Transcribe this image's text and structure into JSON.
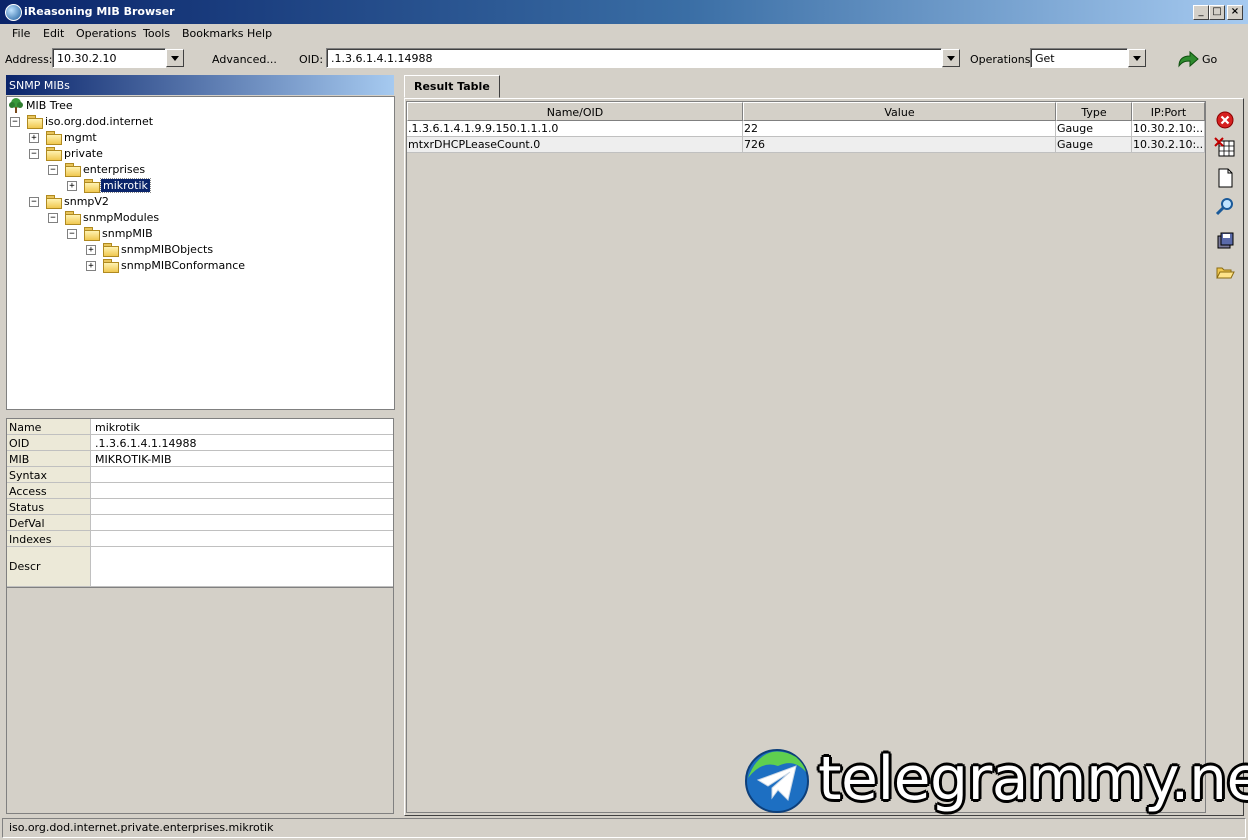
{
  "window": {
    "title": "iReasoning MIB Browser"
  },
  "menu": [
    "File",
    "Edit",
    "Operations",
    "Tools",
    "Bookmarks",
    "Help"
  ],
  "toolbar": {
    "address_label": "Address:",
    "address_value": "10.30.2.10",
    "advanced_label": "Advanced...",
    "oid_label": "OID:",
    "oid_value": ".1.3.6.1.4.1.14988",
    "operations_label": "Operations:",
    "operations_value": "Get",
    "go_label": "Go"
  },
  "left_panel": {
    "header": "SNMP MIBs",
    "tree": [
      {
        "label": "MIB Tree"
      },
      {
        "label": "iso.org.dod.internet"
      },
      {
        "label": "mgmt"
      },
      {
        "label": "private"
      },
      {
        "label": "enterprises"
      },
      {
        "label": "mikrotik"
      },
      {
        "label": "snmpV2"
      },
      {
        "label": "snmpModules"
      },
      {
        "label": "snmpMIB"
      },
      {
        "label": "snmpMIBObjects"
      },
      {
        "label": "snmpMIBConformance"
      }
    ],
    "properties": [
      {
        "key": "Name",
        "value": "mikrotik"
      },
      {
        "key": "OID",
        "value": ".1.3.6.1.4.1.14988"
      },
      {
        "key": "MIB",
        "value": "MIKROTIK-MIB"
      },
      {
        "key": "Syntax",
        "value": ""
      },
      {
        "key": "Access",
        "value": ""
      },
      {
        "key": "Status",
        "value": ""
      },
      {
        "key": "DefVal",
        "value": ""
      },
      {
        "key": "Indexes",
        "value": ""
      },
      {
        "key": "Descr",
        "value": ""
      }
    ]
  },
  "result": {
    "tab": "Result Table",
    "columns": [
      "Name/OID",
      "Value",
      "Type",
      "IP:Port"
    ],
    "rows": [
      [
        ".1.3.6.1.4.1.9.9.150.1.1.1.0",
        "22",
        "Gauge",
        "10.30.2.10:..."
      ],
      [
        "mtxrDHCPLeaseCount.0",
        "726",
        "Gauge",
        "10.30.2.10:..."
      ]
    ]
  },
  "sidebar_icons": [
    "close-red-icon",
    "delete-table-icon",
    "new-document-icon",
    "find-icon",
    "save-icon",
    "open-folder-icon"
  ],
  "status": {
    "text": "iso.org.dod.internet.private.enterprises.mikrotik"
  },
  "watermark": {
    "text": "telegrammy.net"
  },
  "colors": {
    "title_bar": "#0a246a",
    "face": "#d4d0c8",
    "selection": "#0a246a"
  }
}
